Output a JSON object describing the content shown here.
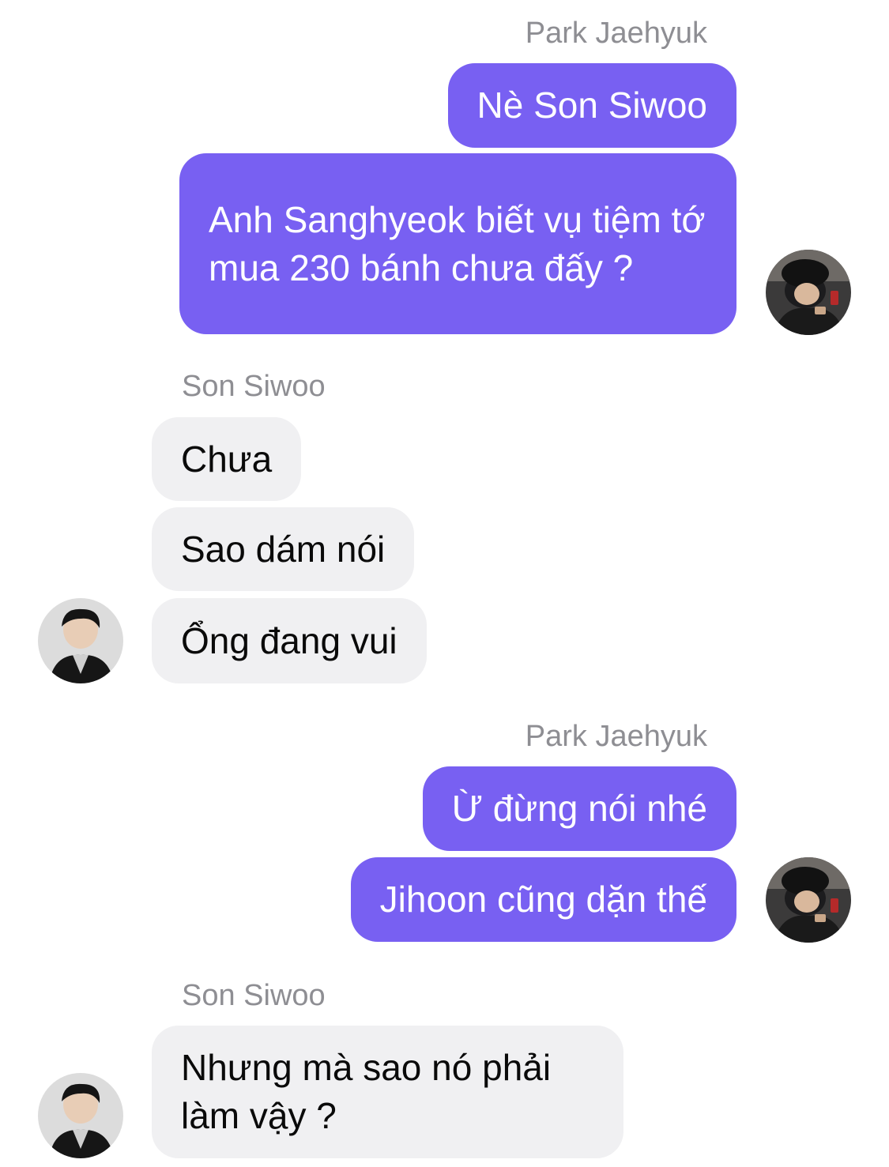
{
  "conversation": {
    "groups": [
      {
        "sender": "Park Jaehyuk",
        "messages": [
          "Nè Son Siwoo",
          "Anh Sanghyeok biết vụ tiệm tớ mua 230 bánh chưa đấy ?"
        ]
      },
      {
        "sender": "Son Siwoo",
        "messages": [
          "Chưa",
          "Sao dám nói",
          "Ổng đang vui"
        ]
      },
      {
        "sender": "Park Jaehyuk",
        "messages": [
          "Ừ đừng nói nhé",
          "Jihoon cũng dặn thế"
        ]
      },
      {
        "sender": "Son Siwoo",
        "messages": [
          "Nhưng mà sao nó phải làm vậy ?"
        ]
      }
    ]
  },
  "theme": {
    "outgoing_bubble_color": "#7860f2",
    "incoming_bubble_color": "#f0f0f2",
    "sender_name_color": "#8e8e93"
  }
}
